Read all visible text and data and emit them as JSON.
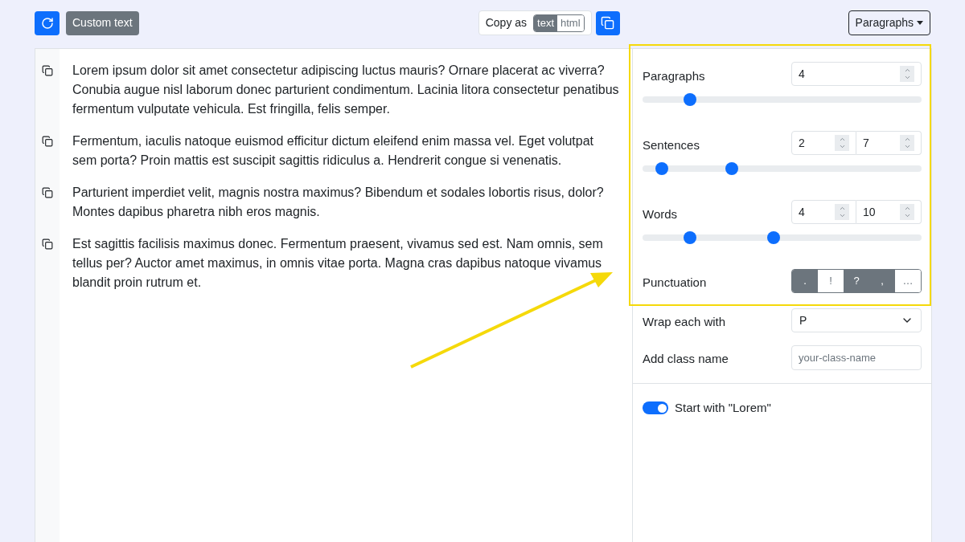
{
  "toolbar": {
    "custom_text_button": "Custom text",
    "copy_as": {
      "label": "Copy as",
      "formats": [
        {
          "label": "text",
          "selected": true
        },
        {
          "label": "html",
          "selected": false
        }
      ]
    },
    "mode_dropdown": "Paragraphs"
  },
  "paragraphs": [
    "Lorem ipsum dolor sit amet consectetur adipiscing luctus mauris? Ornare placerat ac viverra? Conubia augue nisl laborum donec parturient condimentum. Lacinia litora consectetur penatibus fermentum vulputate vehicula. Est fringilla, felis semper.",
    "Fermentum, iaculis natoque euismod efficitur dictum eleifend enim massa vel. Eget volutpat sem porta? Proin mattis est suscipit sagittis ridiculus a. Hendrerit congue si venenatis.",
    "Parturient imperdiet velit, magnis nostra maximus? Bibendum et sodales lobortis risus, dolor? Montes dapibus pharetra nibh eros magnis.",
    "Est sagittis facilisis maximus donec. Fermentum praesent, vivamus sed est. Nam omnis, sem tellus per? Auctor amet maximus, in omnis vitae porta. Magna cras dapibus natoque vivamus blandit proin rutrum et."
  ],
  "settings": {
    "ranges": [
      {
        "label": "Paragraphs",
        "kind": "single",
        "inputs": [
          "4"
        ],
        "thumbs": [
          {
            "level": 0.17
          }
        ]
      },
      {
        "label": "Sentences",
        "kind": "dual",
        "inputs": [
          "2",
          "7"
        ],
        "thumbs": [
          {
            "level": 0.07
          },
          {
            "level": 0.32
          }
        ]
      },
      {
        "label": "Words",
        "kind": "dual",
        "inputs": [
          "4",
          "10"
        ],
        "thumbs": [
          {
            "level": 0.17
          },
          {
            "level": 0.47
          }
        ]
      }
    ],
    "punctuation": {
      "label": "Punctuation",
      "options": [
        {
          "label": ".",
          "selected": true
        },
        {
          "label": "!",
          "selected": false
        },
        {
          "label": "?",
          "selected": true
        },
        {
          "label": ",",
          "selected": true
        },
        {
          "label": "…",
          "selected": false
        }
      ]
    },
    "wrap": {
      "label": "Wrap each with",
      "value": "P"
    },
    "class_name": {
      "label": "Add class name",
      "placeholder": "your-class-name"
    },
    "start_with_lorem": {
      "label": "Start with \"Lorem\"",
      "on": true
    }
  }
}
